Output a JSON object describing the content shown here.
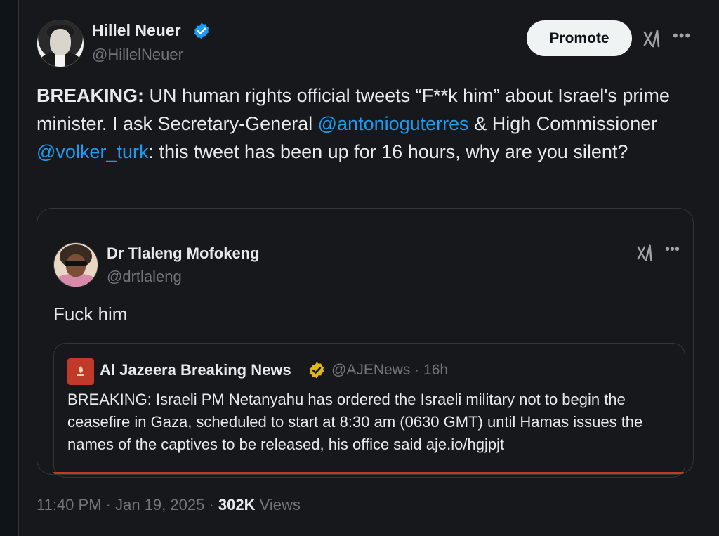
{
  "tweet": {
    "author_name": "Hillel Neuer",
    "author_handle": "@HillelNeuer",
    "promote_label": "Promote",
    "more_icon": "more-dots-icon",
    "grok_icon": "grok-icon",
    "text_prefix": "BREAKING:",
    "text_part1": " UN human rights official tweets “F**k him” about Israel's prime minister. I ask Secretary-General ",
    "mention1": "@antonioguterres",
    "text_part2": " & High Commissioner ",
    "mention2": "@volker_turk",
    "text_part3": ": this tweet has been up for 16 hours, why are you silent?",
    "time": "11:40 PM",
    "sep1": " · ",
    "date": "Jan 19, 2025",
    "sep2": " · ",
    "views_count": "302K",
    "views_label": " Views"
  },
  "quoted": {
    "author_name": "Dr Tlaleng Mofokeng",
    "author_handle": "@drtlaleng",
    "text": "Fuck him",
    "nested": {
      "author_name": "Al Jazeera Breaking News",
      "author_handle": "@AJENews",
      "sep": " · ",
      "time_ago": "16h",
      "text": "BREAKING: Israeli PM Netanyahu has ordered the Israeli military not to begin the ceasefire in Gaza, scheduled to start at 8:30 am (0630 GMT) until Hamas issues the names of the captives to be released, his office said aje.io/hgjpjt"
    }
  },
  "colors": {
    "background": "#16181c",
    "text": "#e7e9ea",
    "secondary": "#71767b",
    "link": "#1d9bf0",
    "verified_blue": "#1d9bf0",
    "verified_gold": "#e2b719",
    "aj_red": "#c0392b"
  }
}
